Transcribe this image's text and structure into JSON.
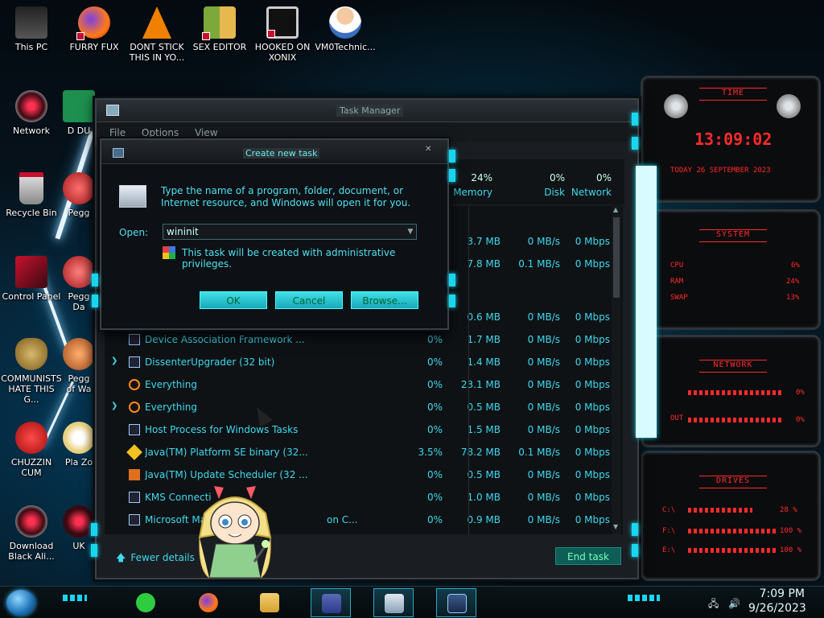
{
  "desktop": {
    "icons": [
      {
        "label": "This PC"
      },
      {
        "label": "FURRY FUX"
      },
      {
        "label": "DONT STICK THIS IN YO..."
      },
      {
        "label": "SEX EDITOR"
      },
      {
        "label": "HOOKED ON XONIX"
      },
      {
        "label": "VM0Technic..."
      },
      {
        "label": "Network"
      },
      {
        "label": "D DU"
      },
      {
        "label": "Recycle Bin"
      },
      {
        "label": "Pegg"
      },
      {
        "label": "Control Panel"
      },
      {
        "label": "Pegg Da"
      },
      {
        "label": "COMMUNISTS HATE THIS G..."
      },
      {
        "label": "Pegg of Wa"
      },
      {
        "label": "CHUZZIN CUM"
      },
      {
        "label": "Pla Zo"
      },
      {
        "label": "Download Black Ali..."
      },
      {
        "label": "UK"
      }
    ]
  },
  "task_manager": {
    "title": "Task Manager",
    "menu": [
      "File",
      "Options",
      "View"
    ],
    "columns": [
      {
        "pct": "24%",
        "name": "Memory"
      },
      {
        "pct": "0%",
        "name": "Disk"
      },
      {
        "pct": "0%",
        "name": "Network"
      }
    ],
    "rows": [
      {
        "name": "",
        "cpu": "",
        "mem": "3.7 MB",
        "disk": "0 MB/s",
        "net": "0 Mbps",
        "expandable": false,
        "icon": ""
      },
      {
        "name": "",
        "cpu": "",
        "mem": "7.8 MB",
        "disk": "0.1 MB/s",
        "net": "0 Mbps",
        "expandable": false,
        "icon": ""
      },
      {
        "name": "",
        "cpu": "",
        "mem": "0.6 MB",
        "disk": "0 MB/s",
        "net": "0 Mbps",
        "expandable": false,
        "icon": ""
      },
      {
        "name": "Device Association Framework ...",
        "cpu": "0%",
        "mem": "1.7 MB",
        "disk": "0 MB/s",
        "net": "0 Mbps",
        "expandable": false,
        "icon": "window-icon"
      },
      {
        "name": "DissenterUpgrader (32 bit)",
        "cpu": "0%",
        "mem": "1.4 MB",
        "disk": "0 MB/s",
        "net": "0 Mbps",
        "expandable": true,
        "icon": "window-icon"
      },
      {
        "name": "Everything",
        "cpu": "0%",
        "mem": "23.1 MB",
        "disk": "0 MB/s",
        "net": "0 Mbps",
        "expandable": false,
        "icon": "magnifier-icon"
      },
      {
        "name": "Everything",
        "cpu": "0%",
        "mem": "0.5 MB",
        "disk": "0 MB/s",
        "net": "0 Mbps",
        "expandable": true,
        "icon": "magnifier-icon"
      },
      {
        "name": "Host Process for Windows Tasks",
        "cpu": "0%",
        "mem": "1.5 MB",
        "disk": "0 MB/s",
        "net": "0 Mbps",
        "expandable": false,
        "icon": "window-icon"
      },
      {
        "name": "Java(TM) Platform SE binary (32...",
        "cpu": "3.5%",
        "mem": "78.2 MB",
        "disk": "0.1 MB/s",
        "net": "0 Mbps",
        "expandable": false,
        "icon": "java-icon"
      },
      {
        "name": "Java(TM) Update Scheduler (32 ...",
        "cpu": "0%",
        "mem": "0.5 MB",
        "disk": "0 MB/s",
        "net": "0 Mbps",
        "expandable": false,
        "icon": "java-update-icon"
      },
      {
        "name": "KMS Connecti",
        "cpu": "0%",
        "mem": "1.0 MB",
        "disk": "0 MB/s",
        "net": "0 Mbps",
        "expandable": false,
        "icon": "window-icon"
      },
      {
        "name": "Microsoft Ma",
        "name_tail": "on C...",
        "cpu": "0%",
        "mem": "0.9 MB",
        "disk": "0 MB/s",
        "net": "0 Mbps",
        "expandable": false,
        "icon": "window-icon"
      }
    ],
    "fewer_details": "Fewer details",
    "end_task": "End task"
  },
  "run_dialog": {
    "title": "Create new task",
    "description": "Type the name of a program, folder, document, or Internet resource, and Windows will open it for you.",
    "open_label": "Open:",
    "input_value": "wininit",
    "admin_note": "This task will be created with administrative privileges.",
    "ok": "OK",
    "cancel": "Cancel",
    "browse": "Browse..."
  },
  "widgets": {
    "time": {
      "title": "TIME",
      "clock": "13:09:02",
      "date": "TODAY 26 SEPTEMBER 2023"
    },
    "system": {
      "title": "SYSTEM",
      "rows": [
        {
          "label": "CPU",
          "value": "6%"
        },
        {
          "label": "RAM",
          "value": "24%"
        },
        {
          "label": "SWAP",
          "value": "13%"
        }
      ]
    },
    "network": {
      "title": "NETWORK",
      "rows": [
        {
          "label": "",
          "value": "0%"
        },
        {
          "label": "OUT",
          "value": "0%"
        }
      ]
    },
    "drives": {
      "title": "DRIVES",
      "rows": [
        {
          "label": "C:\\",
          "value": "28 %"
        },
        {
          "label": "F:\\",
          "value": "100 %"
        },
        {
          "label": "E:\\",
          "value": "100 %"
        }
      ]
    },
    "accent": "#ff2b2b"
  },
  "taskbar": {
    "time": "7:09 PM",
    "date": "9/26/2023",
    "pinned": [
      "notes-icon",
      "firefox-icon",
      "file-explorer-icon",
      "control-panel-icon",
      "task-manager-icon",
      "run-dialog-icon"
    ]
  },
  "colors": {
    "accent_cyan": "#19d6f0",
    "text_cyan": "#3fd8ec",
    "red": "#ff2b2b"
  }
}
